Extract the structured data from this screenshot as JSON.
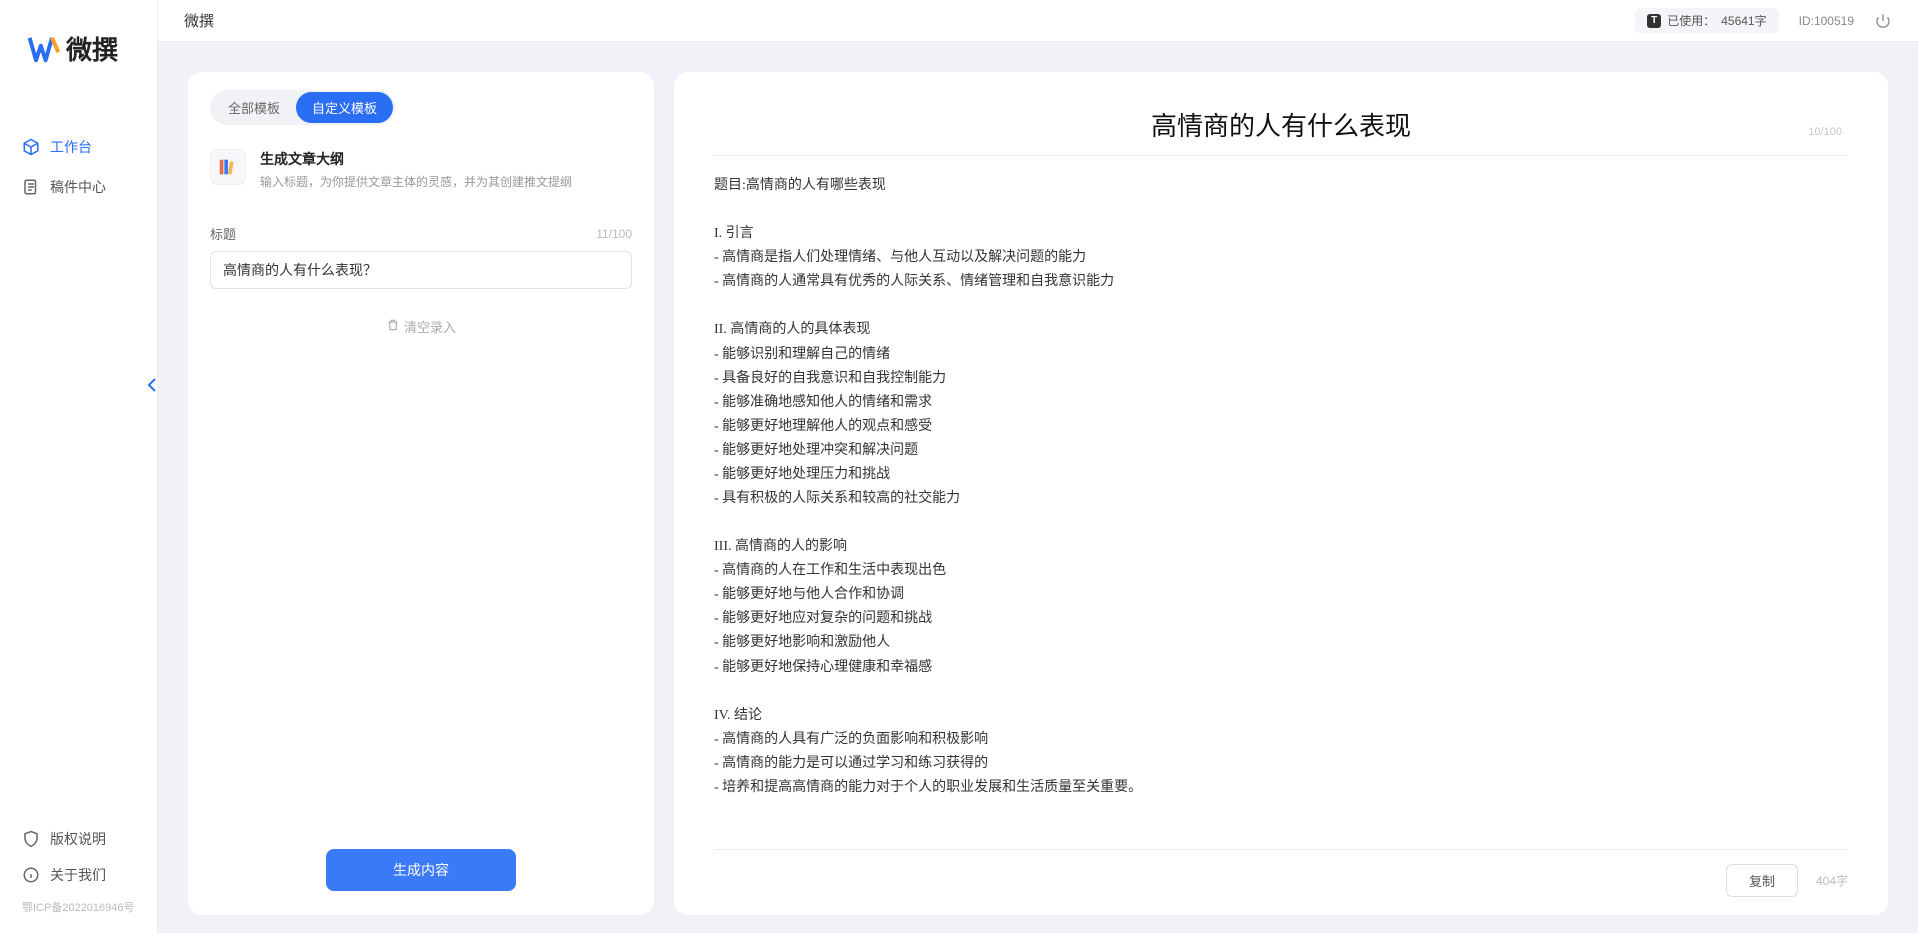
{
  "app_name": "微撰",
  "header": {
    "title": "微撰",
    "usage_prefix": "已使用：",
    "usage_value": "45641字",
    "id_label": "ID:100519"
  },
  "sidebar": {
    "nav": [
      {
        "label": "工作台",
        "icon": "cube",
        "active": true
      },
      {
        "label": "稿件中心",
        "icon": "doc",
        "active": false
      }
    ],
    "footer": [
      {
        "label": "版权说明",
        "icon": "shield"
      },
      {
        "label": "关于我们",
        "icon": "info"
      }
    ],
    "icp": "鄂ICP备2022016946号"
  },
  "left_panel": {
    "tabs": [
      {
        "label": "全部模板",
        "active": false
      },
      {
        "label": "自定义模板",
        "active": true
      }
    ],
    "template": {
      "title": "生成文章大纲",
      "desc": "输入标题，为你提供文章主体的灵感，并为其创建推文提纲"
    },
    "field": {
      "label": "标题",
      "count": "11/100",
      "value": "高情商的人有什么表现？"
    },
    "clear_label": "清空录入",
    "generate_label": "生成内容"
  },
  "right_panel": {
    "title": "高情商的人有什么表现",
    "top_count": "10/100",
    "body": "题目:高情商的人有哪些表现\n\nI. 引言\n- 高情商是指人们处理情绪、与他人互动以及解决问题的能力\n- 高情商的人通常具有优秀的人际关系、情绪管理和自我意识能力\n\nII. 高情商的人的具体表现\n- 能够识别和理解自己的情绪\n- 具备良好的自我意识和自我控制能力\n- 能够准确地感知他人的情绪和需求\n- 能够更好地理解他人的观点和感受\n- 能够更好地处理冲突和解决问题\n- 能够更好地处理压力和挑战\n- 具有积极的人际关系和较高的社交能力\n\nIII. 高情商的人的影响\n- 高情商的人在工作和生活中表现出色\n- 能够更好地与他人合作和协调\n- 能够更好地应对复杂的问题和挑战\n- 能够更好地影响和激励他人\n- 能够更好地保持心理健康和幸福感\n\nIV. 结论\n- 高情商的人具有广泛的负面影响和积极影响\n- 高情商的能力是可以通过学习和练习获得的\n- 培养和提高高情商的能力对于个人的职业发展和生活质量至关重要。",
    "copy_label": "复制",
    "char_count": "404字"
  }
}
